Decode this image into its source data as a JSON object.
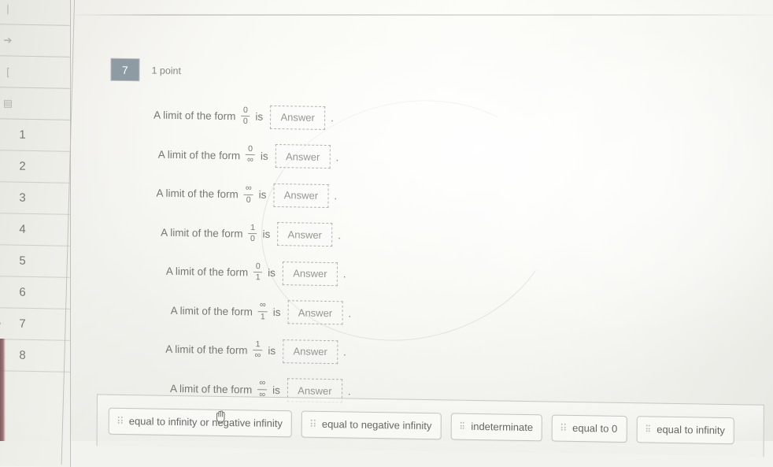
{
  "sidebar": {
    "tool_icons": [
      {
        "name": "cursor-icon",
        "glyph": "|"
      },
      {
        "name": "arrow-right-icon",
        "glyph": "➔"
      },
      {
        "name": "bracket-icon",
        "glyph": "["
      },
      {
        "name": "note-icon",
        "glyph": "▤"
      }
    ],
    "items": [
      {
        "label": "1",
        "marked": false
      },
      {
        "label": "2",
        "marked": false
      },
      {
        "label": "3",
        "marked": false
      },
      {
        "label": "4",
        "marked": false
      },
      {
        "label": "5",
        "marked": false
      },
      {
        "label": "6",
        "marked": false
      },
      {
        "label": "7",
        "marked": true
      },
      {
        "label": "8",
        "marked": true
      }
    ]
  },
  "question": {
    "number": "7",
    "points_label": "1 point",
    "prompt_prefix": "A limit of the form",
    "prompt_connector": "is",
    "answer_placeholder": "Answer",
    "period": ".",
    "rows": [
      {
        "numerator": "0",
        "denominator": "0"
      },
      {
        "numerator": "0",
        "denominator": "∞"
      },
      {
        "numerator": "∞",
        "denominator": "0"
      },
      {
        "numerator": "1",
        "denominator": "0"
      },
      {
        "numerator": "0",
        "denominator": "1"
      },
      {
        "numerator": "∞",
        "denominator": "1"
      },
      {
        "numerator": "1",
        "denominator": "∞"
      },
      {
        "numerator": "∞",
        "denominator": "∞"
      }
    ]
  },
  "answer_bank": {
    "chips": [
      {
        "label": "equal to infinity or negative infinity"
      },
      {
        "label": "equal to negative infinity"
      },
      {
        "label": "indeterminate"
      },
      {
        "label": "equal to 0"
      },
      {
        "label": "equal to infinity"
      }
    ]
  },
  "colors": {
    "badge_bg": "#8e9ba3",
    "badge_text": "#ffffff",
    "body_text": "#6a6a66",
    "page_bg": "#f5f5f1"
  }
}
